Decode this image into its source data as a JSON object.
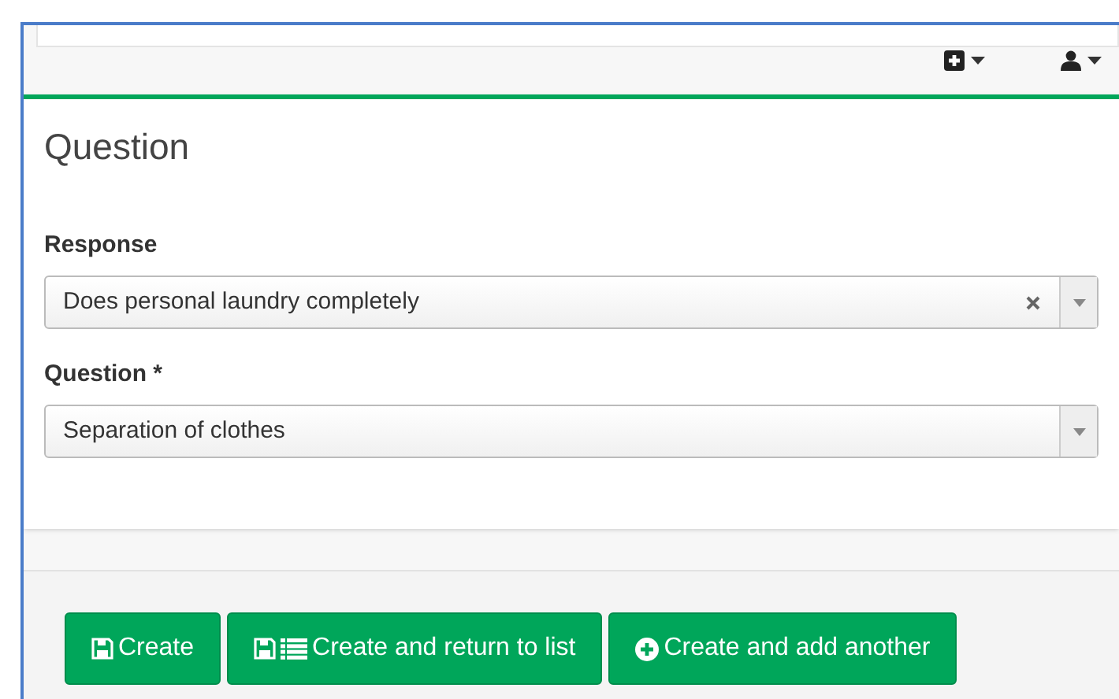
{
  "box": {
    "title": "Question"
  },
  "fields": [
    {
      "label": "Response",
      "value": "Does personal laundry completely",
      "clearable": true
    },
    {
      "label": "Question *",
      "value": "Separation of clothes",
      "clearable": false
    }
  ],
  "buttons": [
    {
      "label": "Create",
      "kind": "save"
    },
    {
      "label": "Create and return to list",
      "kind": "save-list"
    },
    {
      "label": "Create and add another",
      "kind": "add"
    }
  ]
}
